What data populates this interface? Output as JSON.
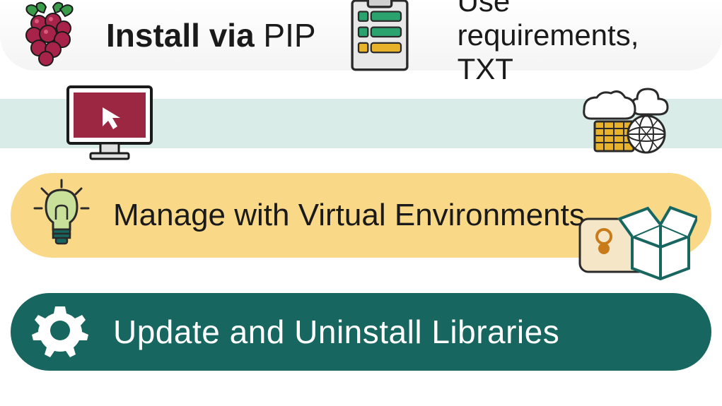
{
  "row1": {
    "install_bold": "Install via",
    "install_normal": " PIP",
    "requirements": "Use requirements, TXT"
  },
  "row3": {
    "text": "Manage with Virtual Environments"
  },
  "row4": {
    "text": "Update and Uninstall Libraries"
  },
  "colors": {
    "teal_dark": "#186660",
    "yellow": "#f9d888",
    "teal_light": "#d9ece7",
    "maroon": "#9b2743"
  }
}
